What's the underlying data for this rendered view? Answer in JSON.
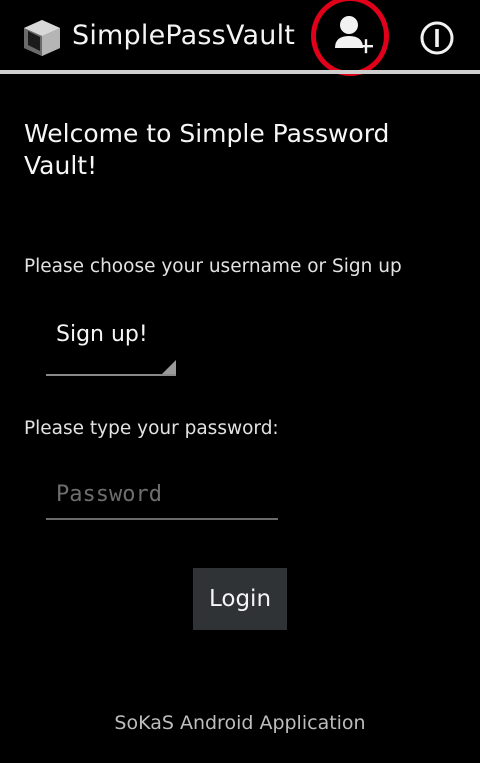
{
  "action_bar": {
    "app_title": "SimplePassVault",
    "icons": {
      "app": "vault-box-icon",
      "add_user": "add-user-icon",
      "info": "info-icon"
    },
    "highlight_color": "#e0001a"
  },
  "main": {
    "welcome": "Welcome to Simple Password Vault!",
    "username_prompt": "Please choose your username or Sign up",
    "username_select": {
      "selected": "Sign up!"
    },
    "password_prompt": "Please type your password:",
    "password_field": {
      "placeholder": "Password",
      "value": ""
    },
    "login_label": "Login"
  },
  "footer": {
    "text": "SoKaS Android Application"
  }
}
